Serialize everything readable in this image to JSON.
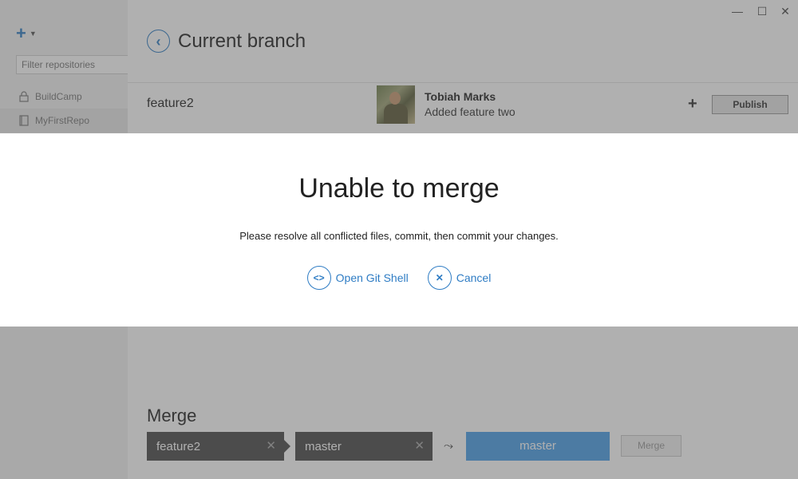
{
  "sidebar": {
    "add_icon": "plus-icon",
    "filter_placeholder": "Filter repositories",
    "repos": [
      {
        "name": "BuildCamp",
        "icon": "lock-icon"
      },
      {
        "name": "MyFirstRepo",
        "icon": "repo-icon"
      }
    ]
  },
  "window": {
    "min": "—",
    "max": "☐",
    "close": "✕"
  },
  "header": {
    "back_icon": "‹",
    "title": "Current branch"
  },
  "branch": {
    "name": "feature2",
    "author": "Tobiah Marks",
    "commit_message": "Added feature two",
    "plus": "+",
    "publish_label": "Publish"
  },
  "merge": {
    "title": "Merge",
    "source": "feature2",
    "target_left": "master",
    "arrow": "⤳",
    "target": "master",
    "button_label": "Merge",
    "remove_icon": "✕"
  },
  "modal": {
    "title": "Unable to merge",
    "message": "Please resolve all conflicted files, commit, then commit your changes.",
    "actions": [
      {
        "label": "Open Git Shell",
        "icon": "<>"
      },
      {
        "label": "Cancel",
        "icon": "✕"
      }
    ]
  },
  "colors": {
    "accent": "#2e7cc4",
    "merge_target": "#4a9ee8",
    "chip": "#4a4a4a"
  }
}
